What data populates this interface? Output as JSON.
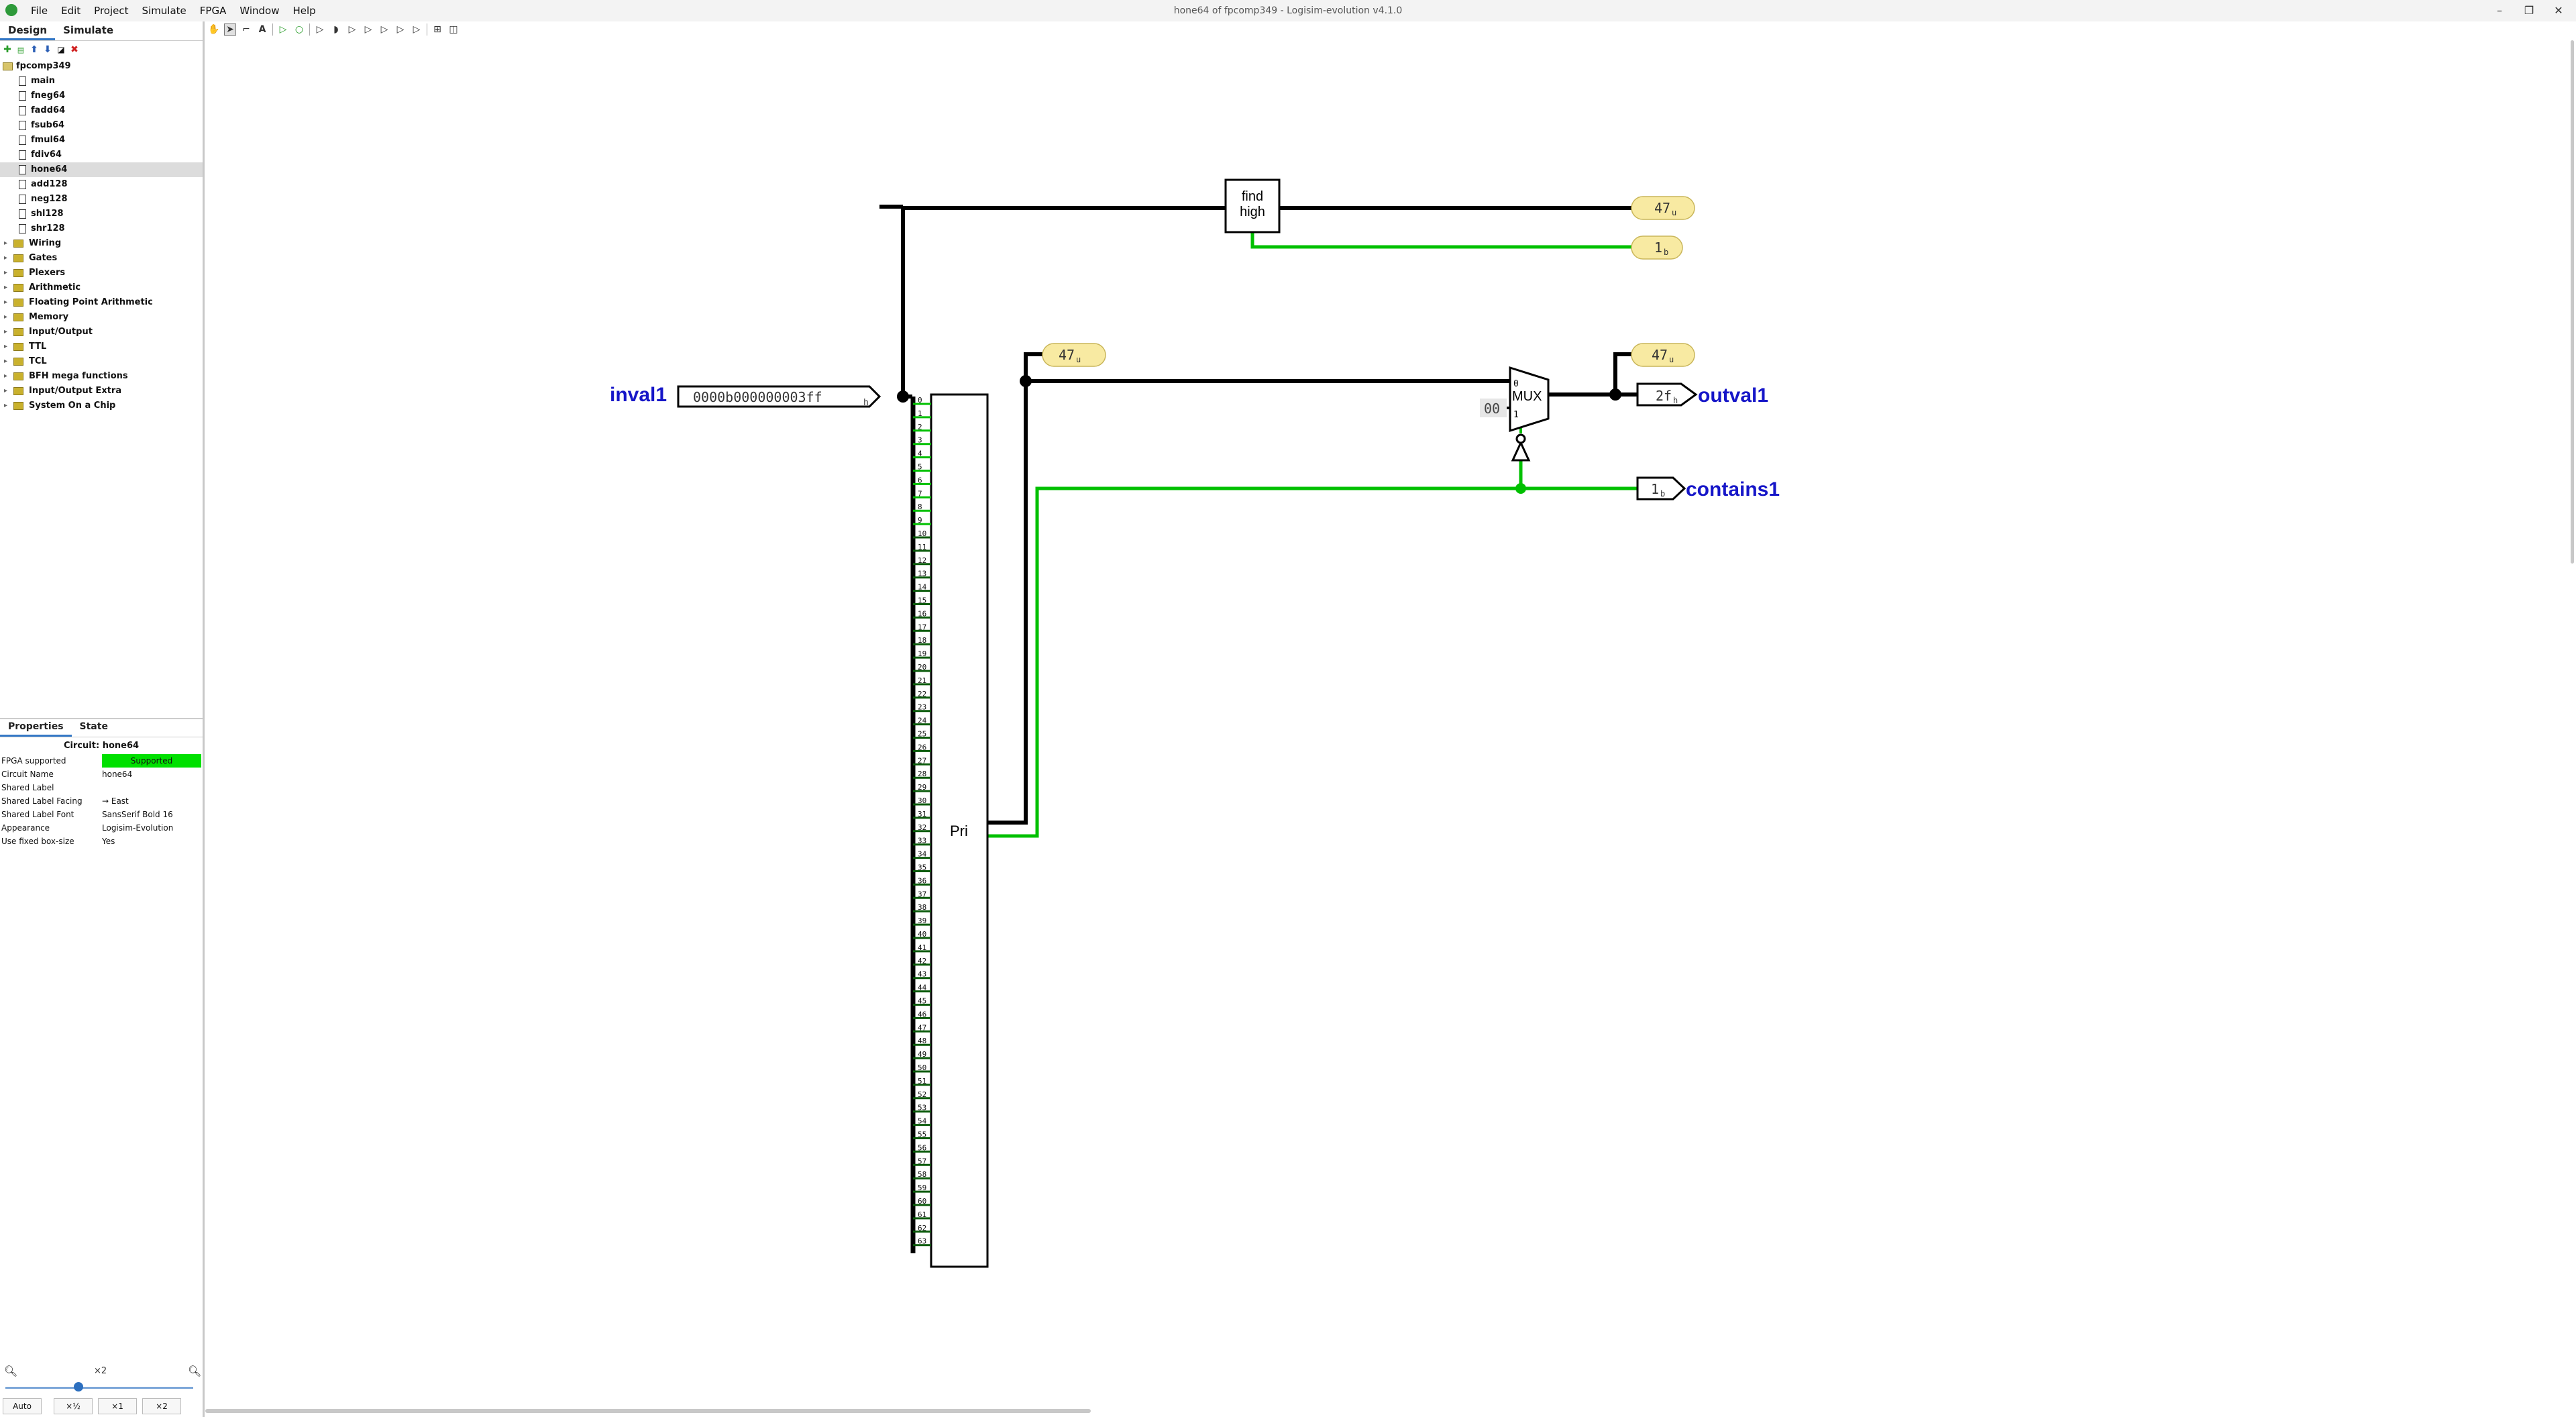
{
  "window": {
    "title": "hone64 of fpcomp349 - Logisim-evolution v4.1.0",
    "controls": [
      "–",
      "❐",
      "✕"
    ]
  },
  "menu": [
    "File",
    "Edit",
    "Project",
    "Simulate",
    "FPGA",
    "Window",
    "Help"
  ],
  "sidebar": {
    "tabs": [
      "Design",
      "Simulate"
    ],
    "active_tab": "Design",
    "toolbar_icons": [
      "add-circuit-icon",
      "add-vhdl-icon",
      "move-up-icon",
      "move-down-icon",
      "edit-appearance-icon",
      "delete-icon"
    ],
    "project": "fpcomp349",
    "circuits": [
      "main",
      "fneg64",
      "fadd64",
      "fsub64",
      "fmul64",
      "fdiv64",
      "hone64",
      "add128",
      "neg128",
      "shl128",
      "shr128"
    ],
    "selected_circuit": "hone64",
    "libraries": [
      "Wiring",
      "Gates",
      "Plexers",
      "Arithmetic",
      "Floating Point Arithmetic",
      "Memory",
      "Input/Output",
      "TTL",
      "TCL",
      "BFH mega functions",
      "Input/Output Extra",
      "System On a Chip"
    ]
  },
  "properties": {
    "tabs": [
      "Properties",
      "State"
    ],
    "title": "Circuit: hone64",
    "rows": [
      {
        "key": "FPGA supported",
        "value": "Supported"
      },
      {
        "key": "Circuit Name",
        "value": "hone64"
      },
      {
        "key": "Shared Label",
        "value": ""
      },
      {
        "key": "Shared Label Facing",
        "value": "→ East"
      },
      {
        "key": "Shared Label Font",
        "value": "SansSerif Bold 16"
      },
      {
        "key": "Appearance",
        "value": "Logisim-Evolution"
      },
      {
        "key": "Use fixed box-size",
        "value": "Yes"
      }
    ]
  },
  "zoom": {
    "label": "×2",
    "buttons": [
      "Auto",
      "×½",
      "×1",
      "×2"
    ]
  },
  "canvas_toolbar": [
    "hand-icon",
    "select-arrow-icon",
    "wiring-icon",
    "text-tool-icon",
    "input-pin-icon",
    "output-pin-icon",
    "not-gate-icon",
    "and-gate-icon",
    "or-gate-icon",
    "buffer-icon",
    "xor-gate-icon",
    "nand-gate-icon",
    "nor-gate-icon",
    "layout-icon",
    "appearance-icon"
  ],
  "circuit": {
    "input_label": "inval1",
    "input_value": "0000b000000003ff",
    "input_base": "h",
    "find_high_line1": "find",
    "find_high_line2": "high",
    "probe_47a": "47",
    "probe_1": "1",
    "probe_47b": "47",
    "probe_47c": "47",
    "probe_unit_u": "u",
    "probe_unit_b": "b",
    "mux_label": "MUX",
    "mux_in0": "0",
    "mux_in1": "1",
    "mux_const": "00",
    "output_label": "outval1",
    "output_value": "2f",
    "output_base": "h",
    "contains_label": "contains1",
    "contains_value": "1",
    "contains_base": "b",
    "pri_label": "Pri",
    "bit_count": 64
  }
}
